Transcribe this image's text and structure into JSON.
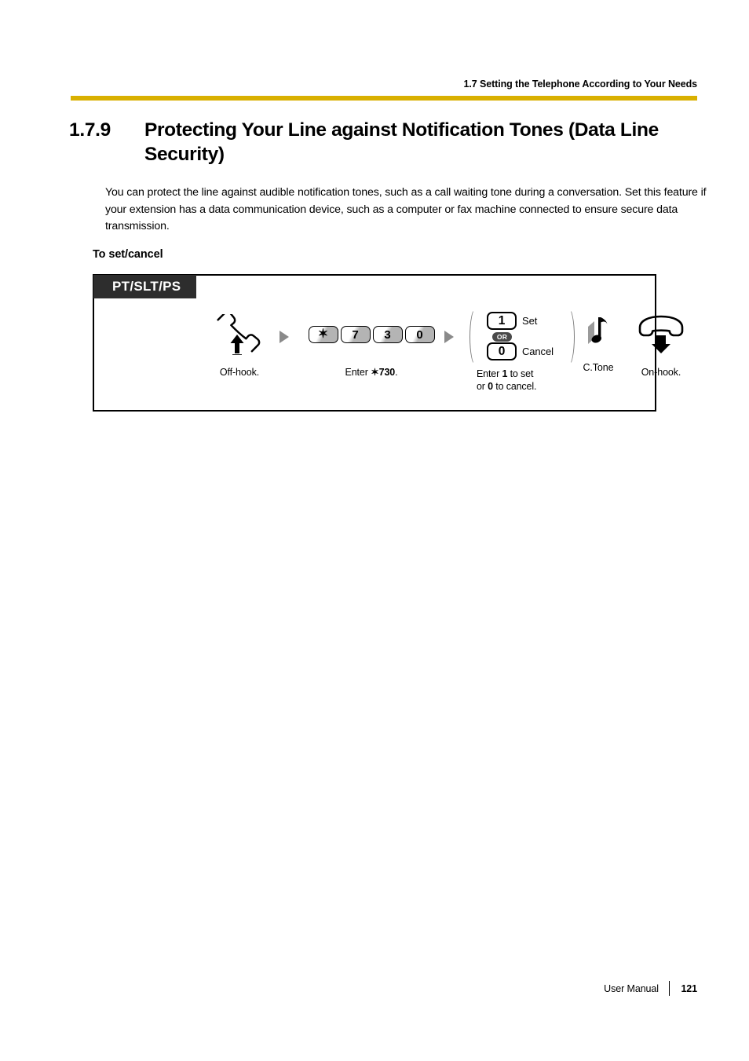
{
  "header": {
    "section_ref": "1.7 Setting the Telephone According to Your Needs",
    "rule_color": "#d9b000"
  },
  "title": {
    "number": "1.7.9",
    "text": "Protecting Your Line against Notification Tones (Data Line Security)"
  },
  "body": {
    "paragraph": "You can protect the line against audible notification tones, such as a call waiting tone during a conversation. Set this feature if your extension has a data communication device, such as a computer or fax machine connected to ensure secure data transmission."
  },
  "subheading": "To set/cancel",
  "flow": {
    "tab_label": "PT/SLT/PS",
    "steps": {
      "offhook": {
        "icon": "handset-offhook-icon",
        "caption": "Off-hook."
      },
      "dial": {
        "keys": [
          "✶",
          "7",
          "3",
          "0"
        ],
        "caption_prefix": "Enter ",
        "caption_code": "✶730",
        "caption_suffix": "."
      },
      "setcancel": {
        "set_key": "1",
        "set_label": "Set",
        "or_label": "OR",
        "cancel_key": "0",
        "cancel_label": "Cancel",
        "caption_line1_a": "Enter ",
        "caption_line1_b": "1",
        "caption_line1_c": " to set",
        "caption_line2_a": "or ",
        "caption_line2_b": "0",
        "caption_line2_c": " to cancel."
      },
      "tone": {
        "icon": "music-note-icon",
        "caption": "C.Tone"
      },
      "onhook": {
        "icon": "handset-onhook-icon",
        "caption": "On-hook."
      }
    }
  },
  "footer": {
    "manual_label": "User Manual",
    "page_number": "121"
  }
}
